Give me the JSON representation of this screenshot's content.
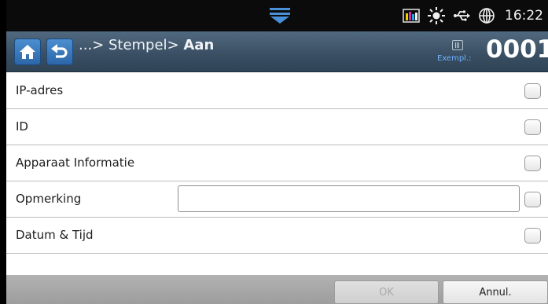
{
  "status_bar": {
    "time": "16:22",
    "icons": [
      "toner-level-icon",
      "brightness-icon",
      "usb-icon",
      "globe-icon"
    ],
    "pull_tab_icon": "chevron-down-icon"
  },
  "header": {
    "home_icon": "home-icon",
    "back_icon": "back-arrow-icon",
    "breadcrumb_prefix": "...> Stempel> ",
    "breadcrumb_current": "Aan",
    "copies_label": "Exempl.:",
    "copies_value": "0001",
    "accent_color": "#3b5064"
  },
  "options": [
    {
      "label": "IP-adres",
      "checked": false
    },
    {
      "label": "ID",
      "checked": false
    },
    {
      "label": "Apparaat Informatie",
      "checked": false
    },
    {
      "label": "Opmerking",
      "checked": false,
      "input_value": ""
    },
    {
      "label": "Datum & Tijd",
      "checked": false
    }
  ],
  "footer": {
    "ok_label": "OK",
    "cancel_label": "Annul."
  }
}
